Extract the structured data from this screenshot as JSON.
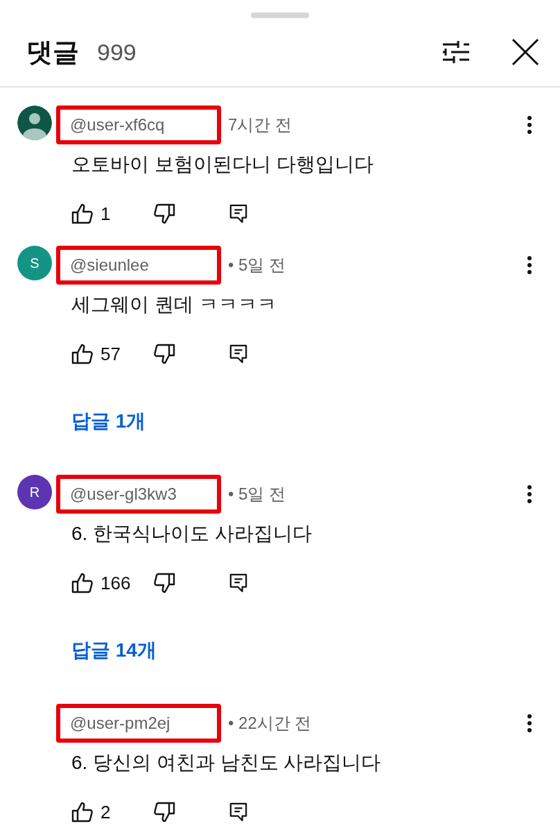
{
  "header": {
    "title": "댓글",
    "count": "999"
  },
  "comments": [
    {
      "avatar": {
        "kind": "silhouette",
        "color": "#0f5647"
      },
      "author": "@user-xf6cq",
      "highlighted": true,
      "time": "7시간 전",
      "text": "오토바이 보험이된다니 다행입니다",
      "likes": "1"
    },
    {
      "avatar": {
        "kind": "letter",
        "letter": "S",
        "color": "#139485"
      },
      "author": "@sieunlee",
      "highlighted": true,
      "time": "• 5일 전",
      "text": "세그웨이 퀀데 ㅋㅋㅋㅋ",
      "likes": "57",
      "replies": "답글 1개"
    },
    {
      "avatar": {
        "kind": "letter",
        "letter": "R",
        "color": "#5e35b1"
      },
      "author": "@user-gl3kw3",
      "highlighted": true,
      "time": "• 5일 전",
      "text": "6. 한국식나이도 사라집니다",
      "likes": "166",
      "replies": "답글 14개"
    },
    {
      "avatar": {
        "kind": "none"
      },
      "author": "@user-pm2ej",
      "highlighted": true,
      "time": "• 22시간 전",
      "text": "6. 당신의 여친과 남친도 사라집니다",
      "likes": "2"
    }
  ]
}
